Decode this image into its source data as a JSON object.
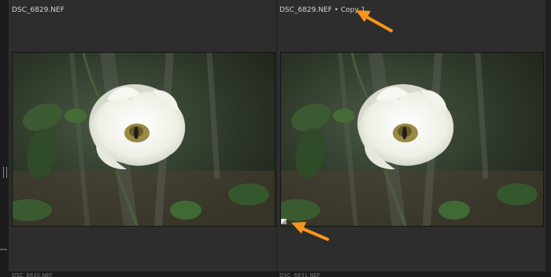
{
  "left_tile": {
    "filename": "DSC_6829.NEF"
  },
  "right_tile": {
    "filename": "DSC_6829.NEF • Copy 1"
  },
  "bottom_labels": [
    "DSC_6830.NEF",
    "DSC_6831.NEF"
  ],
  "colors": {
    "annotation_arrow": "#f7941d",
    "background": "#2b2b2b"
  },
  "icons": {
    "copy_badge": "virtual-copy-icon"
  }
}
